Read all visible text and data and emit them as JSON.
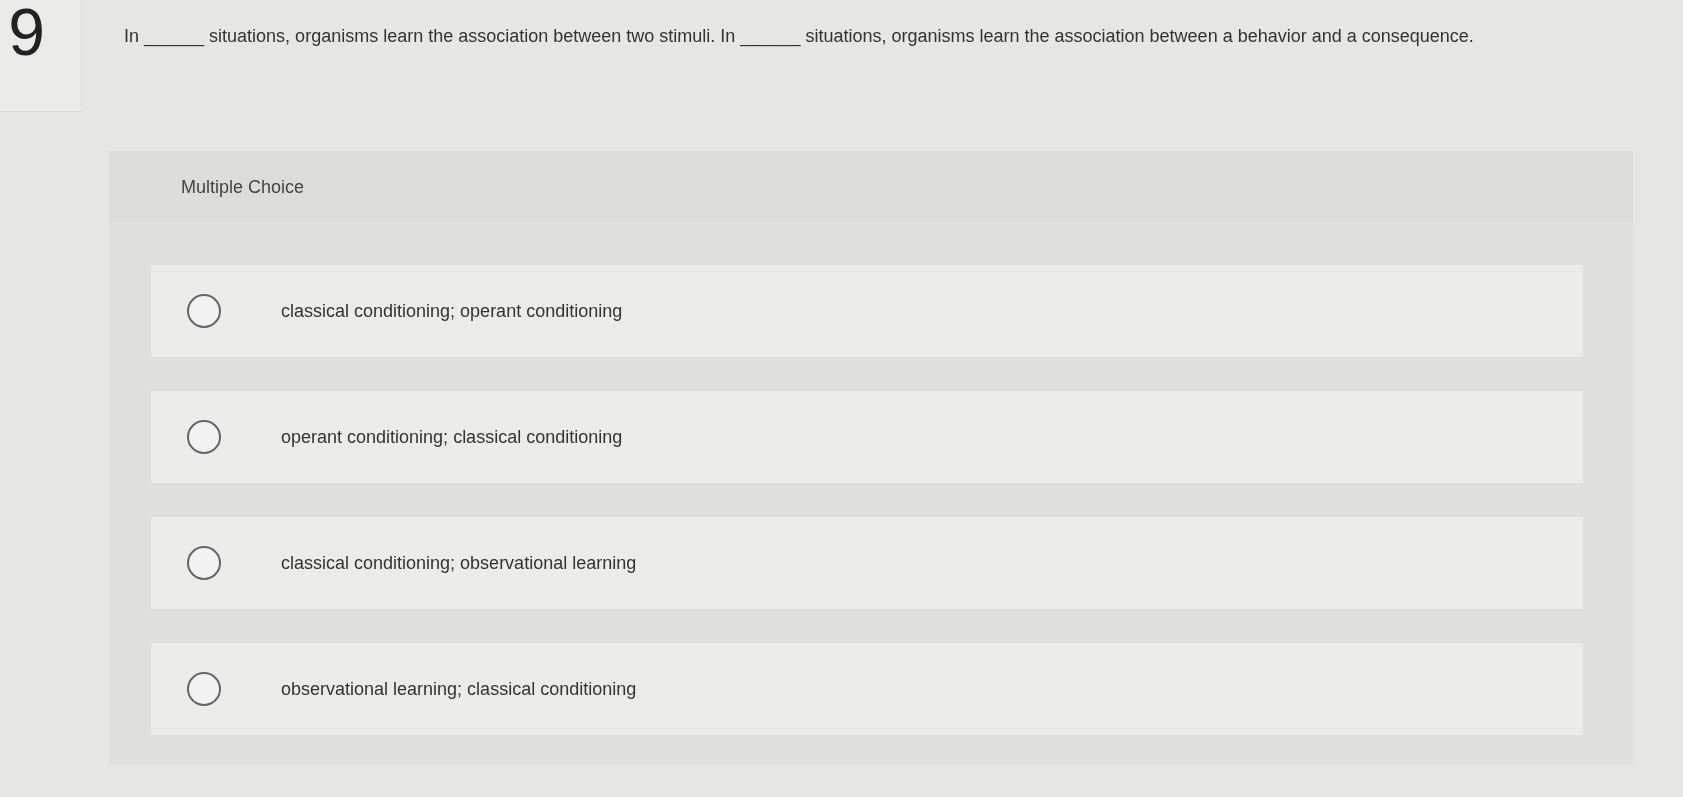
{
  "question": {
    "number": "9",
    "text": "In ______ situations, organisms learn the association between two stimuli. In ______ situations, organisms learn the association between a behavior and a consequence."
  },
  "choices": {
    "heading": "Multiple Choice",
    "options": [
      {
        "label": "classical conditioning; operant conditioning",
        "selected": false
      },
      {
        "label": "operant conditioning; classical conditioning",
        "selected": false
      },
      {
        "label": "classical conditioning; observational learning",
        "selected": false
      },
      {
        "label": "observational learning; classical conditioning",
        "selected": false
      }
    ]
  }
}
